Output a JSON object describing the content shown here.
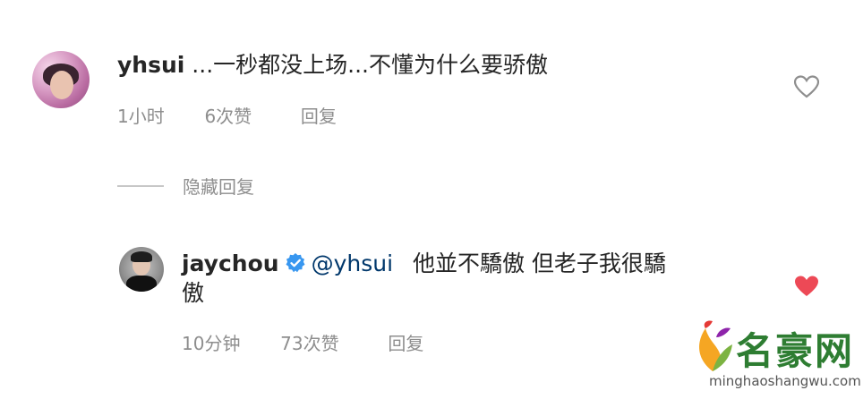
{
  "comment1": {
    "username": "yhsui",
    "text": "...一秒都没上场...不懂为什么要骄傲",
    "time": "1小时",
    "likes": "6次赞",
    "reply": "回复"
  },
  "hidden_replies": "隐藏回复",
  "comment2": {
    "username": "jaychou",
    "mention": "@yhsui",
    "text_line1": "他並不驕傲 但老子我很驕",
    "text_line2": "傲",
    "time": "10分钟",
    "likes": "73次赞",
    "reply": "回复"
  },
  "watermark": {
    "title": "名豪网",
    "url": "minghaoshangwu.com"
  },
  "colors": {
    "liked_heart": "#ed4956",
    "verified": "#3897f0",
    "mention": "#00376b",
    "meta_gray": "#8e8e8e"
  },
  "icons": [
    "heart-outline-icon",
    "heart-filled-icon",
    "verified-badge-icon",
    "leaf-logo-icon"
  ]
}
